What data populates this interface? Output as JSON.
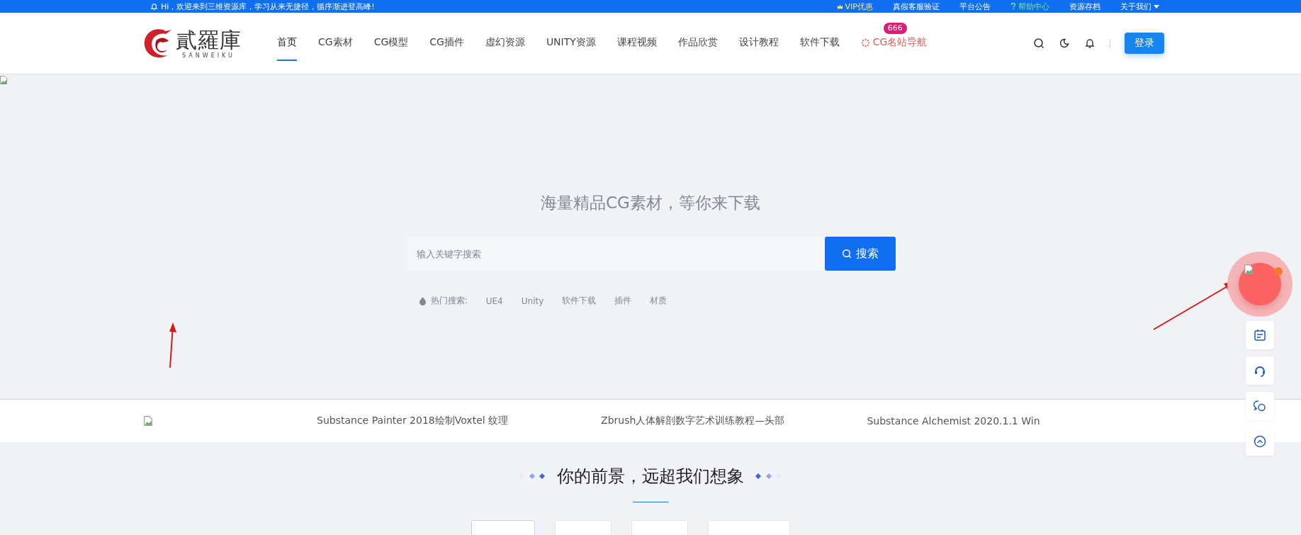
{
  "top_bar": {
    "greeting": "Hi，欢迎来到三维资源库，学习从来无捷径，循序渐进登高峰!",
    "links": [
      {
        "label": "VIP优惠",
        "kind": "vip"
      },
      {
        "label": "真假客服验证",
        "kind": "plain"
      },
      {
        "label": "平台公告",
        "kind": "plain"
      },
      {
        "label": "帮助中心",
        "kind": "help"
      },
      {
        "label": "资源存档",
        "kind": "plain"
      },
      {
        "label": "关于我们",
        "kind": "menu"
      }
    ]
  },
  "header": {
    "logo": {
      "name": "貳羅庫",
      "subtitle": "SANWEIKU"
    },
    "nav": [
      {
        "label": "首页",
        "selected": true,
        "kind": "plain"
      },
      {
        "label": "CG素材",
        "selected": false,
        "kind": "plain"
      },
      {
        "label": "CG模型",
        "selected": false,
        "kind": "plain"
      },
      {
        "label": "CG插件",
        "selected": false,
        "kind": "plain"
      },
      {
        "label": "虚幻资源",
        "selected": false,
        "kind": "plain"
      },
      {
        "label": "UNITY资源",
        "selected": false,
        "kind": "plain"
      },
      {
        "label": "课程视频",
        "selected": false,
        "kind": "plain"
      },
      {
        "label": "作品欣赏",
        "selected": false,
        "kind": "plain"
      },
      {
        "label": "设计教程",
        "selected": false,
        "kind": "plain"
      },
      {
        "label": "软件下载",
        "selected": false,
        "kind": "plain"
      },
      {
        "label": "CG名站导航",
        "selected": false,
        "kind": "special",
        "badge": "666"
      }
    ],
    "login": "登录"
  },
  "hero": {
    "title": "海量精品CG素材，等你来下载",
    "search": {
      "placeholder": "输入关键字搜索",
      "button": "搜索"
    },
    "hot_label": "热门搜索:",
    "hot_terms": [
      "UE4",
      "Unity",
      "软件下载",
      "插件",
      "材质"
    ]
  },
  "ticker": [
    "Substance Painter 2018绘制Voxtel 纹理",
    "Zbrush人体解剖数字艺术训练教程—头部",
    "Substance Alchemist 2020.1.1 Win"
  ],
  "section": {
    "title": "你的前景，远超我们想象",
    "tabs": [
      {
        "selected": true
      },
      {
        "selected": false
      },
      {
        "selected": false
      },
      {
        "selected": false
      }
    ]
  }
}
